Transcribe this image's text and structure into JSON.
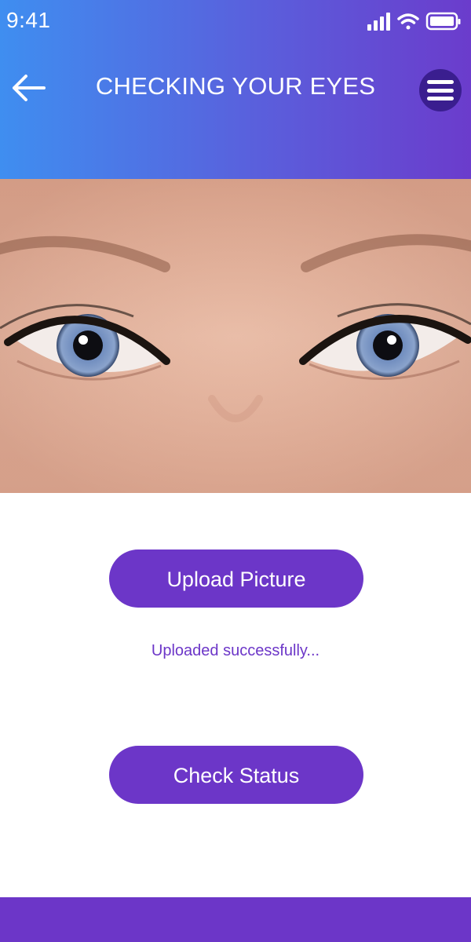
{
  "status_bar": {
    "time": "9:41",
    "icons": [
      "signal-icon",
      "wifi-icon",
      "battery-icon"
    ]
  },
  "header": {
    "back_icon": "arrow-left-icon",
    "title": "CHECKING YOUR EYES",
    "menu_icon": "hamburger-menu-icon"
  },
  "image": {
    "subject": "close-up photo of blue eyes"
  },
  "actions": {
    "upload_label": "Upload Picture",
    "upload_status": "Uploaded successfully...",
    "check_label": "Check Status"
  },
  "colors": {
    "gradient_start": "#3f8ef0",
    "gradient_end": "#6b3ccc",
    "accent": "#6c36c8",
    "menu_circle": "#3a1e8f"
  }
}
